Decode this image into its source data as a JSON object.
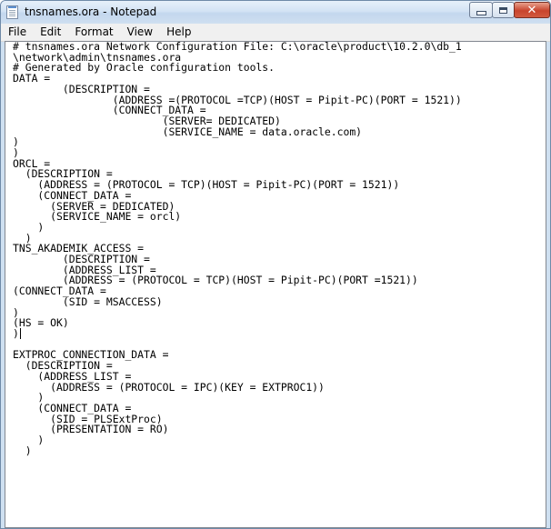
{
  "window": {
    "title": "tnsnames.ora - Notepad"
  },
  "menu": [
    "File",
    "Edit",
    "Format",
    "View",
    "Help"
  ],
  "editor": {
    "lines": [
      "# tnsnames.ora Network Configuration File: C:\\oracle\\product\\10.2.0\\db_1",
      "\\network\\admin\\tnsnames.ora",
      "# Generated by Oracle configuration tools.",
      "DATA =",
      "        (DESCRIPTION =",
      "                (ADDRESS =(PROTOCOL =TCP)(HOST = Pipit-PC)(PORT = 1521))",
      "                (CONNECT_DATA =",
      "                        (SERVER= DEDICATED)",
      "                        (SERVICE_NAME = data.oracle.com)",
      ")",
      ")",
      "ORCL =",
      "  (DESCRIPTION =",
      "    (ADDRESS = (PROTOCOL = TCP)(HOST = Pipit-PC)(PORT = 1521))",
      "    (CONNECT_DATA =",
      "      (SERVER = DEDICATED)",
      "      (SERVICE_NAME = orcl)",
      "    )",
      "  )",
      "TNS_AKADEMIK_ACCESS =",
      "        (DESCRIPTION =",
      "        (ADDRESS_LIST =",
      "        (ADDRESS = (PROTOCOL = TCP)(HOST = Pipit-PC)(PORT =1521))",
      "(CONNECT_DATA =",
      "        (SID = MSACCESS)",
      ")",
      "(HS = OK)",
      ")",
      "",
      "EXTPROC_CONNECTION_DATA =",
      "  (DESCRIPTION =",
      "    (ADDRESS_LIST =",
      "      (ADDRESS = (PROTOCOL = IPC)(KEY = EXTPROC1))",
      "    )",
      "    (CONNECT_DATA =",
      "      (SID = PLSExtProc)",
      "      (PRESENTATION = RO)",
      "    )",
      "  )"
    ]
  },
  "icons": {
    "app": "notepad-icon",
    "minimize": "minimize-icon",
    "maximize": "maximize-icon",
    "close": "close-icon"
  }
}
